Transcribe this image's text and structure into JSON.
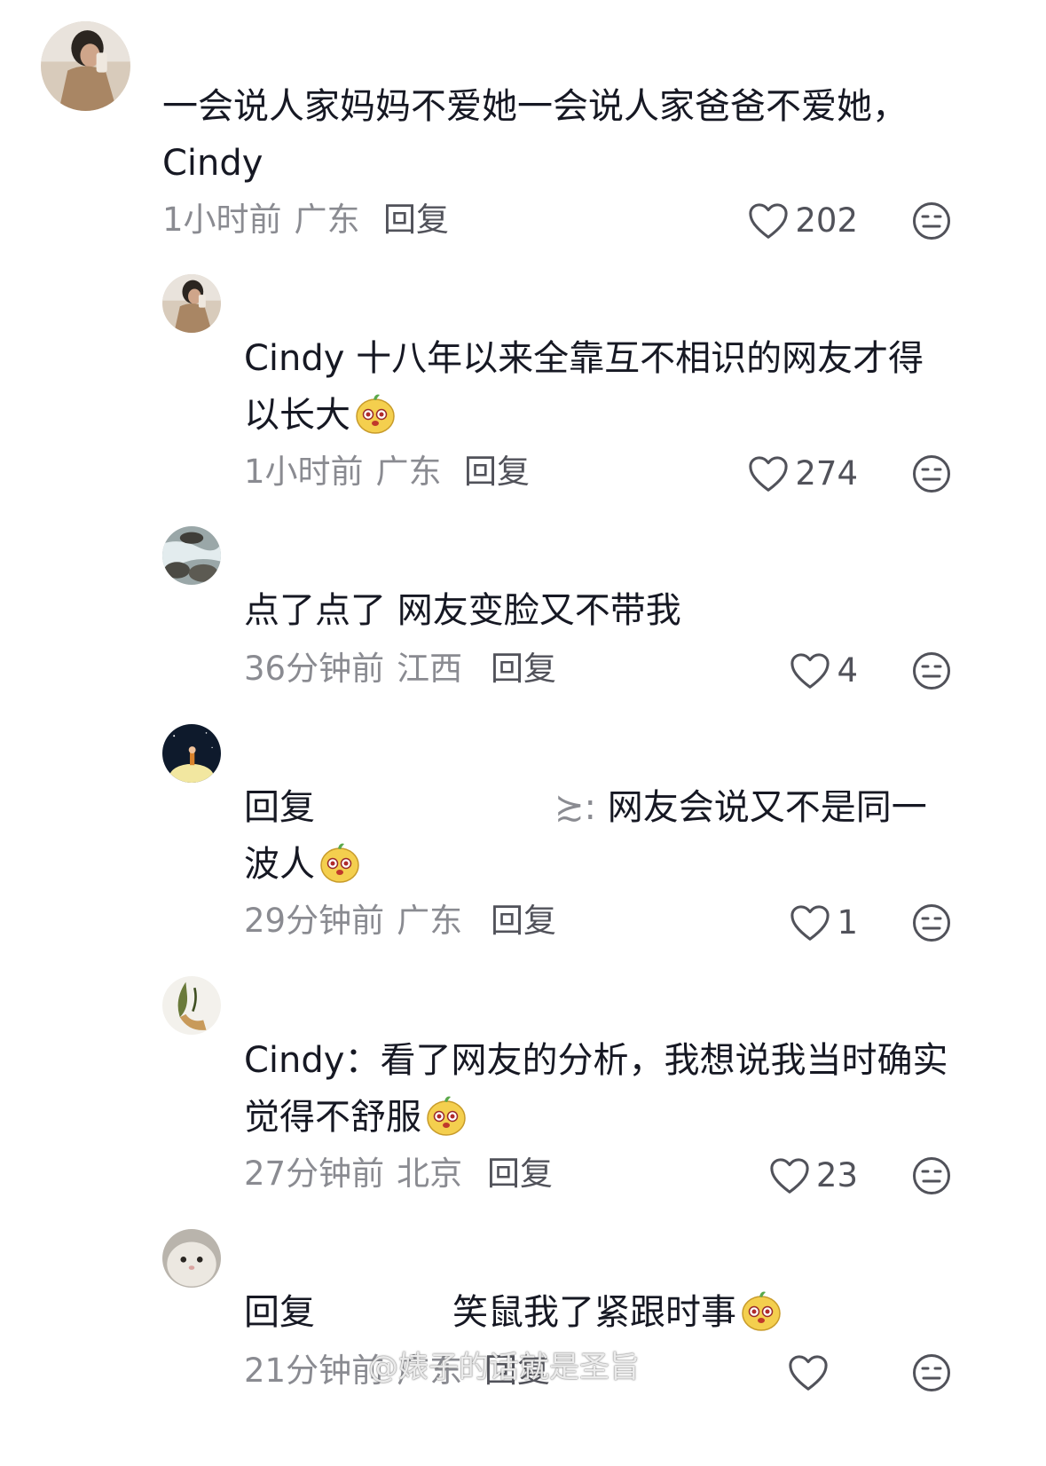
{
  "comments": [
    {
      "text": "一会说人家妈妈不爱她一会说人家爸爸不爱她，Cindy",
      "time": "1小时前",
      "region": "广东",
      "reply_label": "回复",
      "likes": "202",
      "avatar": "avatar-woman-coat",
      "icons": {
        "like": "heart-outline-icon",
        "dislike": "meh-face-icon"
      }
    },
    {
      "text": "Cindy 十八年以来全靠互不相识的网友才得以长大",
      "emoji": "sticker-emoji",
      "time": "1小时前",
      "region": "广东",
      "reply_label": "回复",
      "likes": "274",
      "avatar": "avatar-woman-coat"
    },
    {
      "text": "点了点了 网友变脸又不带我",
      "time": "36分钟前",
      "region": "江西",
      "reply_label": "回复",
      "likes": "4",
      "avatar": "avatar-river-rocks"
    },
    {
      "prefix": "回复",
      "mention_tail": "≿:",
      "text": " 网友会说又不是同一波人",
      "emoji": "sticker-emoji",
      "time": "29分钟前",
      "region": "广东",
      "reply_label": "回复",
      "likes": "1",
      "avatar": "avatar-night-moon"
    },
    {
      "text": "Cindy：看了网友的分析，我想说我当时确实觉得不舒服",
      "emoji": "sticker-emoji",
      "time": "27分钟前",
      "region": "北京",
      "reply_label": "回复",
      "likes": "23",
      "avatar": "avatar-plant-cup"
    },
    {
      "prefix": "回复",
      "text": "笑鼠我了紧跟时事",
      "emoji": "sticker-emoji",
      "time": "21分钟前",
      "region": "广东",
      "reply_label": "回复",
      "likes": "",
      "avatar": "avatar-cat"
    }
  ],
  "watermark": "@婊子的话就是圣旨",
  "colors": {
    "text": "#161823",
    "meta": "#8a8b91",
    "action": "#51525a"
  }
}
